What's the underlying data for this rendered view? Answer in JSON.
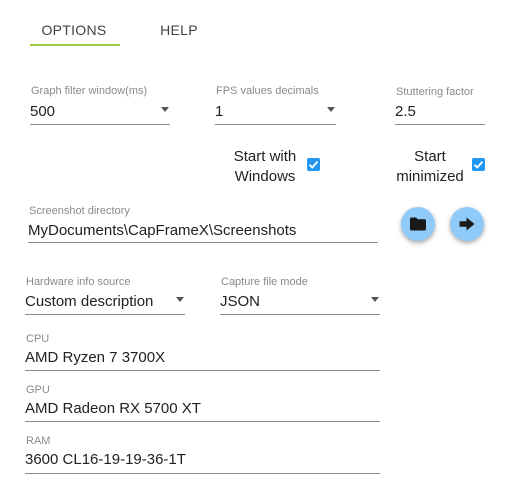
{
  "tabs": [
    {
      "label": "OPTIONS",
      "active": true
    },
    {
      "label": "HELP",
      "active": false
    }
  ],
  "accent_color": "#9ccc3a",
  "checkbox_color": "#2196f3",
  "fields": {
    "graph_filter": {
      "label": "Graph filter window(ms)",
      "value": "500"
    },
    "fps_decimals": {
      "label": "FPS values decimals",
      "value": "1"
    },
    "stuttering": {
      "label": "Stuttering factor",
      "value": "2.5"
    },
    "screenshot_dir": {
      "label": "Screenshot directory",
      "value": "MyDocuments\\CapFrameX\\Screenshots"
    },
    "hw_source": {
      "label": "Hardware info source",
      "value": "Custom description"
    },
    "capture_mode": {
      "label": "Capture file mode",
      "value": "JSON"
    },
    "cpu": {
      "label": "CPU",
      "value": "AMD Ryzen 7 3700X"
    },
    "gpu": {
      "label": "GPU",
      "value": "AMD Radeon RX 5700 XT"
    },
    "ram": {
      "label": "RAM",
      "value": "3600 CL16-19-19-36-1T"
    }
  },
  "checkboxes": {
    "start_with_windows": {
      "label_line1": "Start with",
      "label_line2": "Windows",
      "checked": true
    },
    "start_minimized": {
      "label_line1": "Start",
      "label_line2": "minimized",
      "checked": true
    }
  },
  "buttons": {
    "folder": {
      "icon": "folder-icon"
    },
    "open": {
      "icon": "arrow-right-icon"
    }
  }
}
